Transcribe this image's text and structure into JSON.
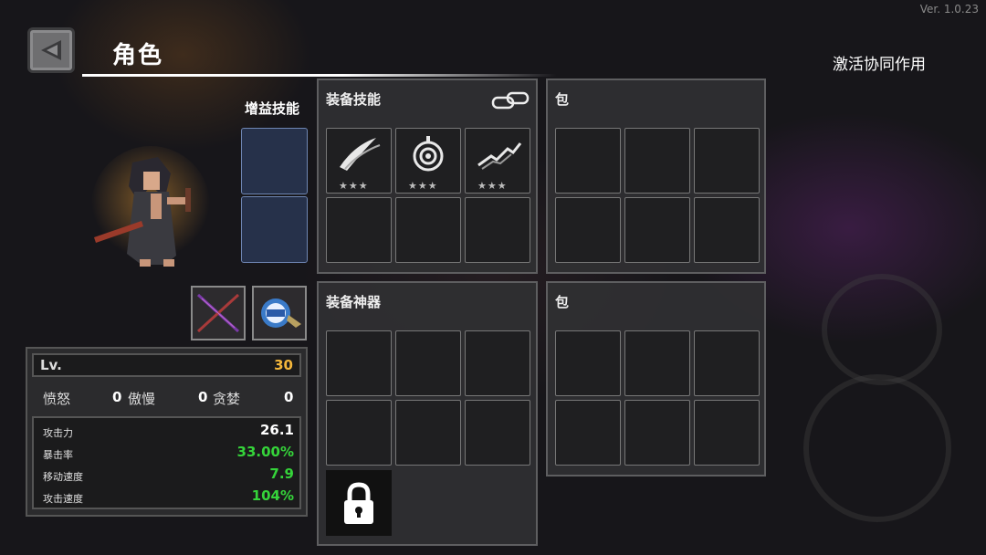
{
  "version": "Ver. 1.0.23",
  "header": {
    "title": "角色",
    "synergy_label": "激活协同作用"
  },
  "buff": {
    "label": "增益技能",
    "slots": 2
  },
  "stats": {
    "level_label": "Lv.",
    "level_value": "30",
    "sins": [
      {
        "label": "愤怒",
        "value": "0"
      },
      {
        "label": "傲慢",
        "value": "0"
      },
      {
        "label": "贪婪",
        "value": "0"
      }
    ],
    "attributes": [
      {
        "label": "攻击力",
        "value": "26.1",
        "color": "#ffffff"
      },
      {
        "label": "暴击率",
        "value": "33.00%",
        "color": "#35d43a"
      },
      {
        "label": "移动速度",
        "value": "7.9",
        "color": "#35d43a"
      },
      {
        "label": "攻击速度",
        "value": "104%",
        "color": "#35d43a"
      }
    ]
  },
  "skills_panel": {
    "title": "装备技能",
    "skills": [
      {
        "icon": "slash-skill-icon",
        "stars": "★★★"
      },
      {
        "icon": "target-skill-icon",
        "stars": "★★★"
      },
      {
        "icon": "lightning-skill-icon",
        "stars": "★★★"
      }
    ]
  },
  "bag_top": {
    "title": "包"
  },
  "artifacts_panel": {
    "title": "装备神器"
  },
  "bag_bottom": {
    "title": "包"
  },
  "colors": {
    "accent_gold": "#f4b73b",
    "accent_green": "#35d43a",
    "buff_slot": "#26314a"
  }
}
